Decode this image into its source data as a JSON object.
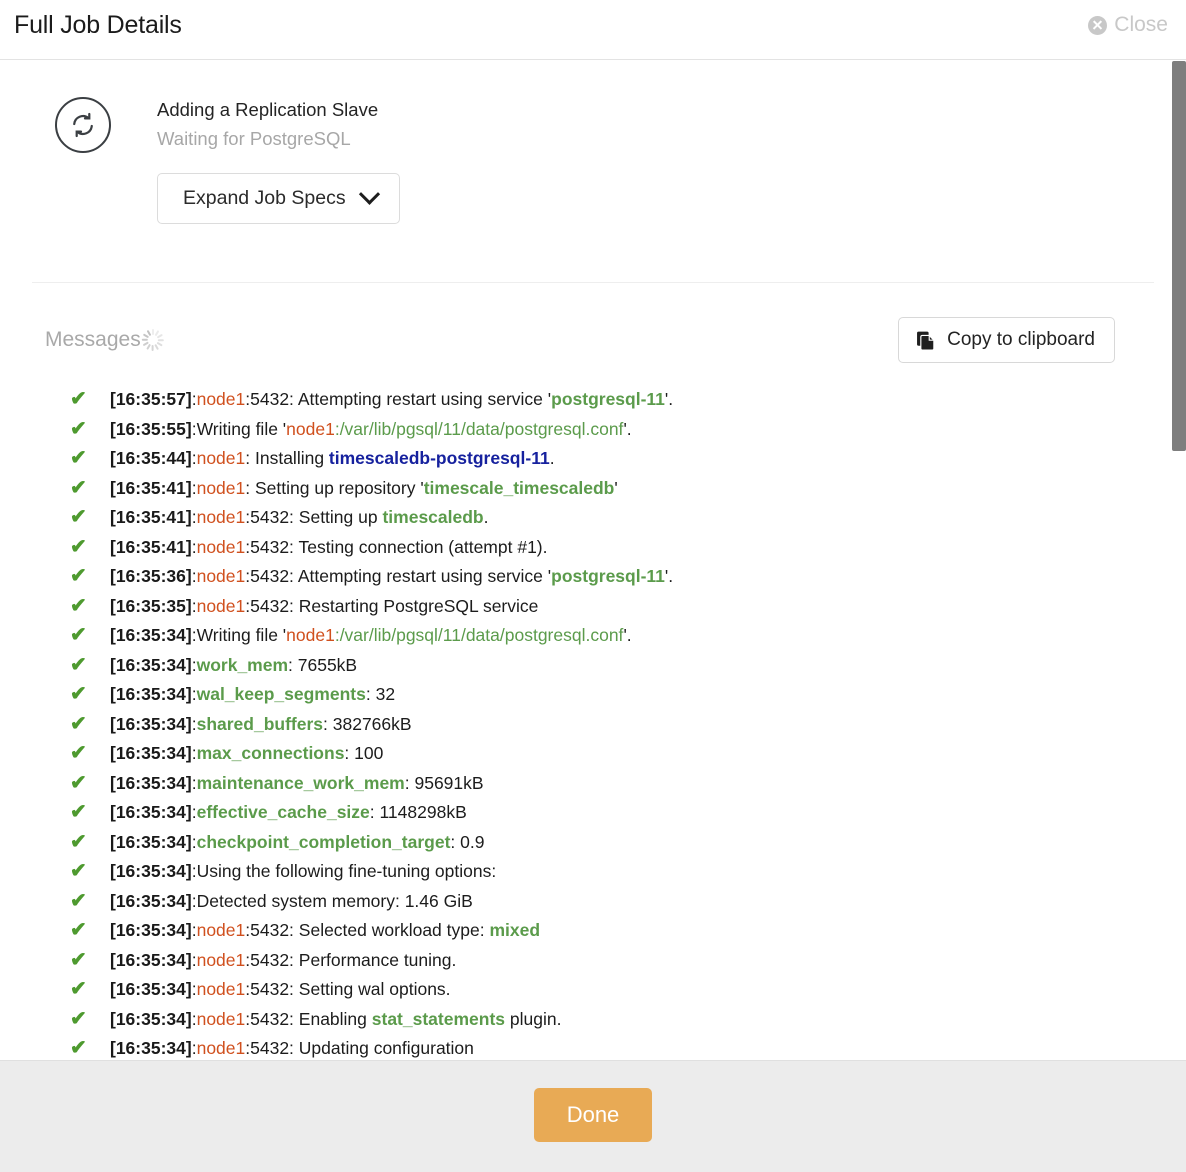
{
  "header": {
    "title": "Full Job Details",
    "close_label": "Close",
    "close_icon": "close-circle-icon"
  },
  "job": {
    "status_icon": "refresh-sync-icon",
    "name": "Adding a Replication Slave",
    "state": "Waiting for PostgreSQL",
    "expand_button": "Expand Job Specs",
    "expand_icon": "chevron-down-icon"
  },
  "messages": {
    "label": "Messages",
    "spinner_icon": "loading-spinner-icon",
    "copy_button": "Copy to clipboard",
    "copy_icon": "clipboard-icon",
    "check_glyph": "✔",
    "entries": [
      {
        "time": "[16:35:57]",
        "parts": [
          {
            "t": ":",
            "c": "plain"
          },
          {
            "t": "node1",
            "c": "node"
          },
          {
            "t": ":5432: Attempting restart using service '",
            "c": "plain"
          },
          {
            "t": "postgresql-11",
            "c": "green"
          },
          {
            "t": "'.",
            "c": "plain"
          }
        ]
      },
      {
        "time": "[16:35:55]",
        "parts": [
          {
            "t": ":Writing file '",
            "c": "plain"
          },
          {
            "t": "node1",
            "c": "node"
          },
          {
            "t": ":/var/lib/pgsql/11/data/postgresql.conf",
            "c": "greenp"
          },
          {
            "t": "'.",
            "c": "plain"
          }
        ]
      },
      {
        "time": "[16:35:44]",
        "parts": [
          {
            "t": ":",
            "c": "plain"
          },
          {
            "t": "node1",
            "c": "node"
          },
          {
            "t": ": Installing ",
            "c": "plain"
          },
          {
            "t": "timescaledb-postgresql-11",
            "c": "blue"
          },
          {
            "t": ".",
            "c": "plain"
          }
        ]
      },
      {
        "time": "[16:35:41]",
        "parts": [
          {
            "t": ":",
            "c": "plain"
          },
          {
            "t": "node1",
            "c": "node"
          },
          {
            "t": ": Setting up repository '",
            "c": "plain"
          },
          {
            "t": "timescale_timescaledb",
            "c": "green"
          },
          {
            "t": "'",
            "c": "plain"
          }
        ]
      },
      {
        "time": "[16:35:41]",
        "parts": [
          {
            "t": ":",
            "c": "plain"
          },
          {
            "t": "node1",
            "c": "node"
          },
          {
            "t": ":5432: Setting up ",
            "c": "plain"
          },
          {
            "t": "timescaledb",
            "c": "green"
          },
          {
            "t": ".",
            "c": "plain"
          }
        ]
      },
      {
        "time": "[16:35:41]",
        "parts": [
          {
            "t": ":",
            "c": "plain"
          },
          {
            "t": "node1",
            "c": "node"
          },
          {
            "t": ":5432: Testing connection (attempt #1).",
            "c": "plain"
          }
        ]
      },
      {
        "time": "[16:35:36]",
        "parts": [
          {
            "t": ":",
            "c": "plain"
          },
          {
            "t": "node1",
            "c": "node"
          },
          {
            "t": ":5432: Attempting restart using service '",
            "c": "plain"
          },
          {
            "t": "postgresql-11",
            "c": "green"
          },
          {
            "t": "'.",
            "c": "plain"
          }
        ]
      },
      {
        "time": "[16:35:35]",
        "parts": [
          {
            "t": ":",
            "c": "plain"
          },
          {
            "t": "node1",
            "c": "node"
          },
          {
            "t": ":5432: Restarting PostgreSQL service",
            "c": "plain"
          }
        ]
      },
      {
        "time": "[16:35:34]",
        "parts": [
          {
            "t": ":Writing file '",
            "c": "plain"
          },
          {
            "t": "node1",
            "c": "node"
          },
          {
            "t": ":/var/lib/pgsql/11/data/postgresql.conf",
            "c": "greenp"
          },
          {
            "t": "'.",
            "c": "plain"
          }
        ]
      },
      {
        "time": "[16:35:34]",
        "parts": [
          {
            "t": ":",
            "c": "plain"
          },
          {
            "t": "work_mem",
            "c": "green"
          },
          {
            "t": ": 7655kB",
            "c": "plain"
          }
        ]
      },
      {
        "time": "[16:35:34]",
        "parts": [
          {
            "t": ":",
            "c": "plain"
          },
          {
            "t": "wal_keep_segments",
            "c": "green"
          },
          {
            "t": ": 32",
            "c": "plain"
          }
        ]
      },
      {
        "time": "[16:35:34]",
        "parts": [
          {
            "t": ":",
            "c": "plain"
          },
          {
            "t": "shared_buffers",
            "c": "green"
          },
          {
            "t": ": 382766kB",
            "c": "plain"
          }
        ]
      },
      {
        "time": "[16:35:34]",
        "parts": [
          {
            "t": ":",
            "c": "plain"
          },
          {
            "t": "max_connections",
            "c": "green"
          },
          {
            "t": ": 100",
            "c": "plain"
          }
        ]
      },
      {
        "time": "[16:35:34]",
        "parts": [
          {
            "t": ":",
            "c": "plain"
          },
          {
            "t": "maintenance_work_mem",
            "c": "green"
          },
          {
            "t": ": 95691kB",
            "c": "plain"
          }
        ]
      },
      {
        "time": "[16:35:34]",
        "parts": [
          {
            "t": ":",
            "c": "plain"
          },
          {
            "t": "effective_cache_size",
            "c": "green"
          },
          {
            "t": ": 1148298kB",
            "c": "plain"
          }
        ]
      },
      {
        "time": "[16:35:34]",
        "parts": [
          {
            "t": ":",
            "c": "plain"
          },
          {
            "t": "checkpoint_completion_target",
            "c": "green"
          },
          {
            "t": ": 0.9",
            "c": "plain"
          }
        ]
      },
      {
        "time": "[16:35:34]",
        "parts": [
          {
            "t": ":Using the following fine-tuning options:",
            "c": "plain"
          }
        ]
      },
      {
        "time": "[16:35:34]",
        "parts": [
          {
            "t": ":Detected system memory: 1.46 GiB",
            "c": "plain"
          }
        ]
      },
      {
        "time": "[16:35:34]",
        "parts": [
          {
            "t": ":",
            "c": "plain"
          },
          {
            "t": "node1",
            "c": "node"
          },
          {
            "t": ":5432: Selected workload type: ",
            "c": "plain"
          },
          {
            "t": "mixed",
            "c": "green"
          }
        ]
      },
      {
        "time": "[16:35:34]",
        "parts": [
          {
            "t": ":",
            "c": "plain"
          },
          {
            "t": "node1",
            "c": "node"
          },
          {
            "t": ":5432: Performance tuning.",
            "c": "plain"
          }
        ]
      },
      {
        "time": "[16:35:34]",
        "parts": [
          {
            "t": ":",
            "c": "plain"
          },
          {
            "t": "node1",
            "c": "node"
          },
          {
            "t": ":5432: Setting wal options.",
            "c": "plain"
          }
        ]
      },
      {
        "time": "[16:35:34]",
        "parts": [
          {
            "t": ":",
            "c": "plain"
          },
          {
            "t": "node1",
            "c": "node"
          },
          {
            "t": ":5432: Enabling ",
            "c": "plain"
          },
          {
            "t": "stat_statements",
            "c": "green"
          },
          {
            "t": " plugin.",
            "c": "plain"
          }
        ]
      },
      {
        "time": "[16:35:34]",
        "parts": [
          {
            "t": ":",
            "c": "plain"
          },
          {
            "t": "node1",
            "c": "node"
          },
          {
            "t": ":5432: Updating configuration",
            "c": "plain"
          }
        ]
      }
    ]
  },
  "footer": {
    "done_label": "Done"
  },
  "colors": {
    "accent_done": "#e8aa55",
    "node": "#d0501e",
    "config_key": "#5b9b4b",
    "package": "#16219e",
    "check": "#4e9a2f",
    "muted": "#a7a7a7"
  }
}
